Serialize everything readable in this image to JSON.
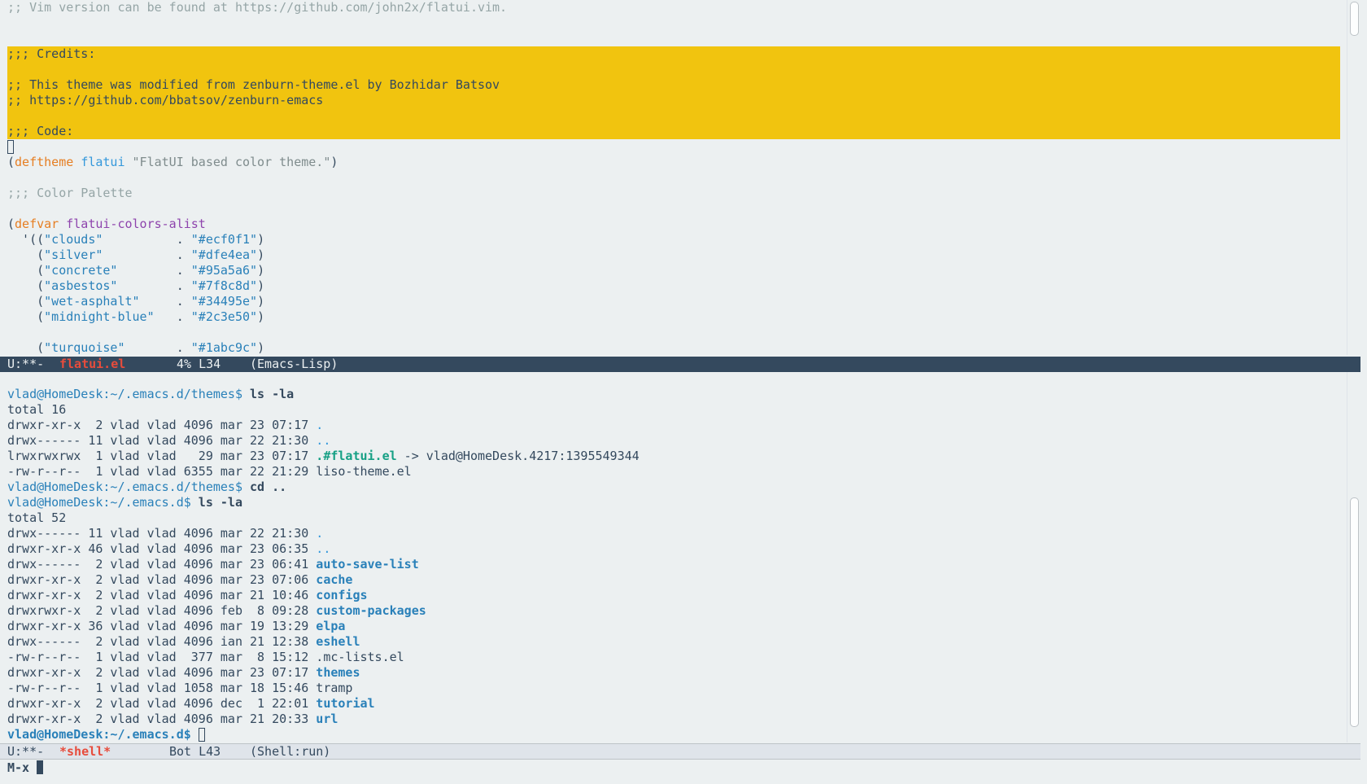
{
  "editor": {
    "lines": [
      {
        "parts": [
          {
            "t": ";; Vim version can be found at https://github.com/john2x/flatui.vim.",
            "c": "c-comment"
          }
        ]
      },
      {
        "parts": [
          {
            "t": ";;; Credits:",
            "c": ""
          }
        ]
      },
      {
        "parts": [
          {
            "t": ";; This theme was modified from zenburn-theme.el by Bozhidar Batsov",
            "c": ""
          }
        ]
      },
      {
        "parts": [
          {
            "t": ";; https://github.com/bbatsov/zenburn-emacs",
            "c": ""
          }
        ]
      },
      {
        "parts": [
          {
            "t": ";;; Code:",
            "c": ""
          }
        ]
      },
      {
        "parts": [
          {
            "t": "(",
            "c": ""
          },
          {
            "t": "deftheme",
            "c": "c-kw"
          },
          {
            "t": " ",
            "c": ""
          },
          {
            "t": "flatui",
            "c": "c-fn"
          },
          {
            "t": " ",
            "c": ""
          },
          {
            "t": "\"FlatUI based color theme.\"",
            "c": "c-doc"
          },
          {
            "t": ")",
            "c": ""
          }
        ]
      },
      {
        "parts": [
          {
            "t": ";;; Color Palette",
            "c": "c-comment"
          }
        ]
      },
      {
        "parts": [
          {
            "t": "(",
            "c": ""
          },
          {
            "t": "defvar",
            "c": "c-kw"
          },
          {
            "t": " ",
            "c": ""
          },
          {
            "t": "flatui-colors-alist",
            "c": "c-var"
          }
        ]
      },
      {
        "parts": [
          {
            "t": "  '((",
            "c": ""
          },
          {
            "t": "\"clouds\"",
            "c": "c-str"
          },
          {
            "t": "          . ",
            "c": ""
          },
          {
            "t": "\"#ecf0f1\"",
            "c": "c-str"
          },
          {
            "t": ")",
            "c": ""
          }
        ]
      },
      {
        "parts": [
          {
            "t": "    (",
            "c": ""
          },
          {
            "t": "\"silver\"",
            "c": "c-str"
          },
          {
            "t": "          . ",
            "c": ""
          },
          {
            "t": "\"#dfe4ea\"",
            "c": "c-str"
          },
          {
            "t": ")",
            "c": ""
          }
        ]
      },
      {
        "parts": [
          {
            "t": "    (",
            "c": ""
          },
          {
            "t": "\"concrete\"",
            "c": "c-str"
          },
          {
            "t": "        . ",
            "c": ""
          },
          {
            "t": "\"#95a5a6\"",
            "c": "c-str"
          },
          {
            "t": ")",
            "c": ""
          }
        ]
      },
      {
        "parts": [
          {
            "t": "    (",
            "c": ""
          },
          {
            "t": "\"asbestos\"",
            "c": "c-str"
          },
          {
            "t": "        . ",
            "c": ""
          },
          {
            "t": "\"#7f8c8d\"",
            "c": "c-str"
          },
          {
            "t": ")",
            "c": ""
          }
        ]
      },
      {
        "parts": [
          {
            "t": "    (",
            "c": ""
          },
          {
            "t": "\"wet-asphalt\"",
            "c": "c-str"
          },
          {
            "t": "     . ",
            "c": ""
          },
          {
            "t": "\"#34495e\"",
            "c": "c-str"
          },
          {
            "t": ")",
            "c": ""
          }
        ]
      },
      {
        "parts": [
          {
            "t": "    (",
            "c": ""
          },
          {
            "t": "\"midnight-blue\"",
            "c": "c-str"
          },
          {
            "t": "   . ",
            "c": ""
          },
          {
            "t": "\"#2c3e50\"",
            "c": "c-str"
          },
          {
            "t": ")",
            "c": ""
          }
        ]
      },
      {
        "parts": [
          {
            "t": "    (",
            "c": ""
          },
          {
            "t": "\"turquoise\"",
            "c": "c-str"
          },
          {
            "t": "       . ",
            "c": ""
          },
          {
            "t": "\"#1abc9c\"",
            "c": "c-str"
          },
          {
            "t": ")",
            "c": ""
          }
        ]
      }
    ]
  },
  "modeline_top": {
    "status": "U:**-",
    "buffer": "flatui.el",
    "position": "4% L34",
    "mode": "(Emacs-Lisp)"
  },
  "shell": {
    "lines": [
      {
        "parts": [
          {
            "t": "vlad@HomeDesk:~/.emacs.d/themes$",
            "c": "c-prompt"
          },
          {
            "t": " ls -la",
            "c": "bold"
          }
        ]
      },
      {
        "parts": [
          {
            "t": "total 16",
            "c": ""
          }
        ]
      },
      {
        "parts": [
          {
            "t": "drwxr-xr-x  2 vlad vlad 4096 mar 23 07:17 ",
            "c": ""
          },
          {
            "t": ".",
            "c": "c-dot"
          }
        ]
      },
      {
        "parts": [
          {
            "t": "drwx------ 11 vlad vlad 4096 mar 22 21:30 ",
            "c": ""
          },
          {
            "t": "..",
            "c": "c-dot"
          }
        ]
      },
      {
        "parts": [
          {
            "t": "lrwxrwxrwx  1 vlad vlad   29 mar 23 07:17 ",
            "c": ""
          },
          {
            "t": ".#flatui.el",
            "c": "c-link"
          },
          {
            "t": " -> vlad@HomeDesk.4217:1395549344",
            "c": ""
          }
        ]
      },
      {
        "parts": [
          {
            "t": "-rw-r--r--  1 vlad vlad 6355 mar 22 21:29 liso-theme.el",
            "c": ""
          }
        ]
      },
      {
        "parts": [
          {
            "t": "vlad@HomeDesk:~/.emacs.d/themes$",
            "c": "c-prompt"
          },
          {
            "t": " cd ..",
            "c": "bold"
          }
        ]
      },
      {
        "parts": [
          {
            "t": "vlad@HomeDesk:~/.emacs.d$",
            "c": "c-prompt"
          },
          {
            "t": " ls -la",
            "c": "bold"
          }
        ]
      },
      {
        "parts": [
          {
            "t": "total 52",
            "c": ""
          }
        ]
      },
      {
        "parts": [
          {
            "t": "drwx------ 11 vlad vlad 4096 mar 22 21:30 ",
            "c": ""
          },
          {
            "t": ".",
            "c": "c-dot"
          }
        ]
      },
      {
        "parts": [
          {
            "t": "drwxr-xr-x 46 vlad vlad 4096 mar 23 06:35 ",
            "c": ""
          },
          {
            "t": "..",
            "c": "c-dot"
          }
        ]
      },
      {
        "parts": [
          {
            "t": "drwx------  2 vlad vlad 4096 mar 23 06:41 ",
            "c": ""
          },
          {
            "t": "auto-save-list",
            "c": "c-dir"
          }
        ]
      },
      {
        "parts": [
          {
            "t": "drwxr-xr-x  2 vlad vlad 4096 mar 23 07:06 ",
            "c": ""
          },
          {
            "t": "cache",
            "c": "c-dir"
          }
        ]
      },
      {
        "parts": [
          {
            "t": "drwxr-xr-x  2 vlad vlad 4096 mar 21 10:46 ",
            "c": ""
          },
          {
            "t": "configs",
            "c": "c-dir"
          }
        ]
      },
      {
        "parts": [
          {
            "t": "drwxrwxr-x  2 vlad vlad 4096 feb  8 09:28 ",
            "c": ""
          },
          {
            "t": "custom-packages",
            "c": "c-dir"
          }
        ]
      },
      {
        "parts": [
          {
            "t": "drwxr-xr-x 36 vlad vlad 4096 mar 19 13:29 ",
            "c": ""
          },
          {
            "t": "elpa",
            "c": "c-dir"
          }
        ]
      },
      {
        "parts": [
          {
            "t": "drwx------  2 vlad vlad 4096 ian 21 12:38 ",
            "c": ""
          },
          {
            "t": "eshell",
            "c": "c-dir"
          }
        ]
      },
      {
        "parts": [
          {
            "t": "-rw-r--r--  1 vlad vlad  377 mar  8 15:12 .mc-lists.el",
            "c": ""
          }
        ]
      },
      {
        "parts": [
          {
            "t": "drwxr-xr-x  2 vlad vlad 4096 mar 23 07:17 ",
            "c": ""
          },
          {
            "t": "themes",
            "c": "c-dir"
          }
        ]
      },
      {
        "parts": [
          {
            "t": "-rw-r--r--  1 vlad vlad 1058 mar 18 15:46 tramp",
            "c": ""
          }
        ]
      },
      {
        "parts": [
          {
            "t": "drwxr-xr-x  2 vlad vlad 4096 dec  1 22:01 ",
            "c": ""
          },
          {
            "t": "tutorial",
            "c": "c-dir"
          }
        ]
      },
      {
        "parts": [
          {
            "t": "drwxr-xr-x  2 vlad vlad 4096 mar 21 20:33 ",
            "c": ""
          },
          {
            "t": "url",
            "c": "c-dir"
          }
        ]
      },
      {
        "parts": [
          {
            "t": "vlad@HomeDesk:~/.emacs.d$",
            "c": "c-prompt bold"
          },
          {
            "t": " ",
            "c": ""
          }
        ]
      }
    ]
  },
  "modeline_bottom": {
    "status": "U:**-",
    "buffer": "*shell*",
    "position": "Bot L43",
    "mode": "(Shell:run)"
  },
  "minibuffer": {
    "prompt": "M-x"
  }
}
